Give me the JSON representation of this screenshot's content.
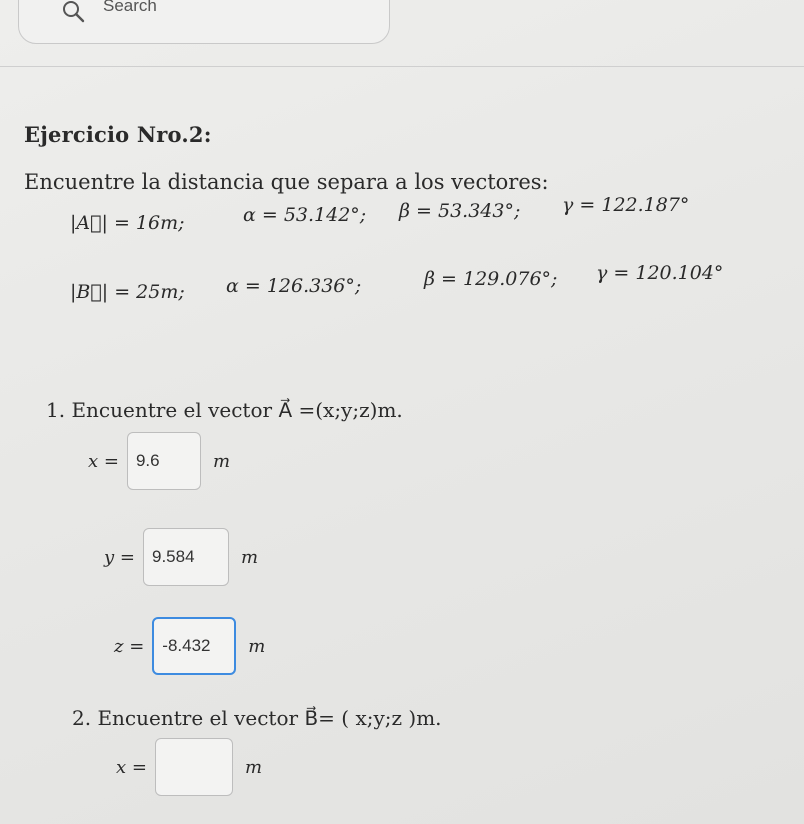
{
  "search": {
    "placeholder": "Search"
  },
  "exercise": {
    "title": "Ejercicio Nro.2:",
    "statement": "Encuentre la distancia que separa a los vectores:"
  },
  "vectors": [
    {
      "magnitude": "|A⃗| = 16m;",
      "alpha": "α = 53.142°;",
      "beta": "β = 53.343°;",
      "gamma": "γ = 122.187°"
    },
    {
      "magnitude": "|B⃗| = 25m;",
      "alpha": "α = 126.336°;",
      "beta": "β = 129.076°;",
      "gamma": "γ = 120.104°"
    }
  ],
  "question1": {
    "prefix": "1. Encuentre el vector ",
    "vector": "A⃗",
    "suffix": " =(x;y;z)m.",
    "fields": [
      {
        "label": "x =",
        "value": "9.6",
        "unit": "m"
      },
      {
        "label": "y =",
        "value": "9.584",
        "unit": "m"
      },
      {
        "label": "z =",
        "value": "-8.432",
        "unit": "m"
      }
    ]
  },
  "question2": {
    "prefix": "2. Encuentre el vector ",
    "vector": "B⃗",
    "suffix": "= ( x;y;z )m.",
    "fields": [
      {
        "label": "x =",
        "value": "",
        "unit": "m"
      }
    ]
  },
  "colors": {
    "focus_border": "#3d8be0",
    "background": "#e8e8e6"
  }
}
